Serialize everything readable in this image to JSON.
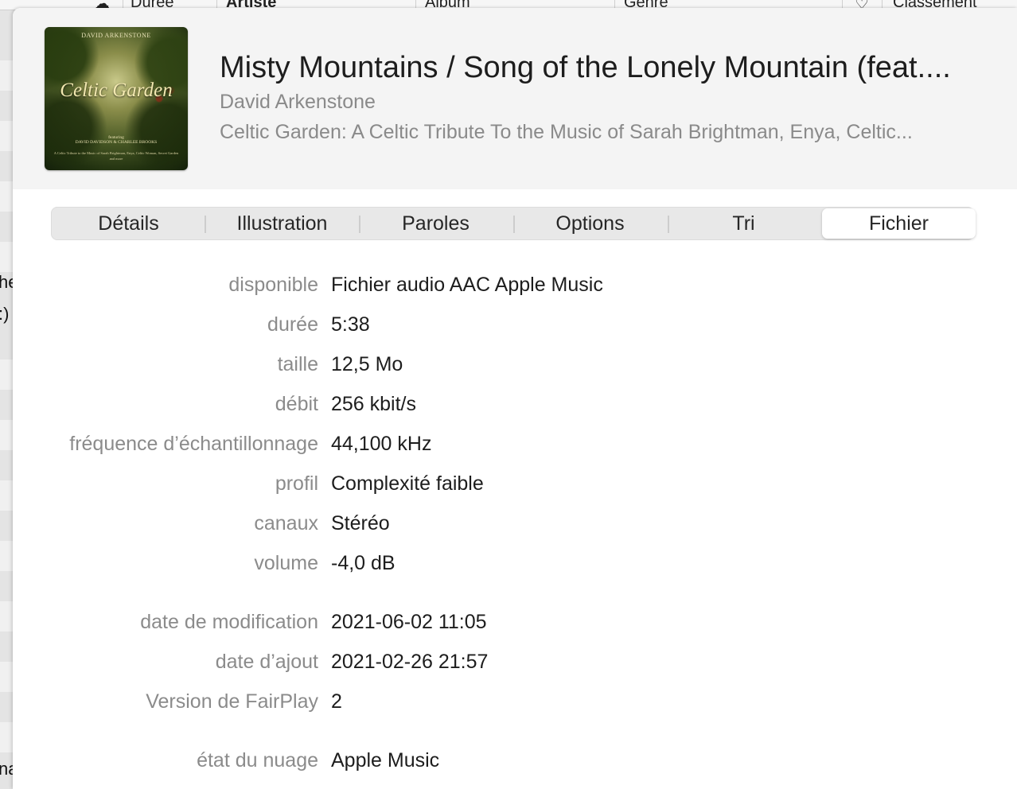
{
  "background": {
    "columns": [
      {
        "label": "Durée"
      },
      {
        "label": "Artiste"
      },
      {
        "label": "Album"
      },
      {
        "label": "Genre"
      },
      {
        "label": "Classement"
      }
    ],
    "left_fragments": [
      "he",
      ":)",
      "na"
    ]
  },
  "track": {
    "artwork": {
      "top_text": "DAVID ARKENSTONE",
      "title": "Celtic Garden",
      "featuring_label": "featuring",
      "credit": "DAVID DAVIDSON & CHARLEE BROOKS",
      "subtitle": "A Celtic Tribute to the Music of Sarah Brightman, Enya, Celtic Woman, Secret Garden and more"
    },
    "title": "Misty Mountains / Song of the Lonely Mountain (feat....",
    "artist": "David Arkenstone",
    "album": "Celtic Garden: A Celtic Tribute To the Music of Sarah Brightman, Enya, Celtic..."
  },
  "tabs": [
    {
      "label": "Détails",
      "selected": false
    },
    {
      "label": "Illustration",
      "selected": false
    },
    {
      "label": "Paroles",
      "selected": false
    },
    {
      "label": "Options",
      "selected": false
    },
    {
      "label": "Tri",
      "selected": false
    },
    {
      "label": "Fichier",
      "selected": true
    }
  ],
  "file_info": [
    {
      "label": "disponible",
      "value": "Fichier audio AAC Apple Music"
    },
    {
      "label": "durée",
      "value": "5:38"
    },
    {
      "label": "taille",
      "value": "12,5 Mo"
    },
    {
      "label": "débit",
      "value": "256 kbit/s"
    },
    {
      "label": "fréquence d’échantillonnage",
      "value": "44,100 kHz"
    },
    {
      "label": "profil",
      "value": "Complexité faible"
    },
    {
      "label": "canaux",
      "value": "Stéréo"
    },
    {
      "label": "volume",
      "value": "-4,0 dB"
    },
    {
      "label": "date de modification",
      "value": "2021-06-02 11:05"
    },
    {
      "label": "date d’ajout",
      "value": "2021-02-26 21:57"
    },
    {
      "label": "Version de FairPlay",
      "value": "2"
    },
    {
      "label": "état du nuage",
      "value": "Apple Music"
    }
  ],
  "colors": {
    "label_gray": "#8b8b8b",
    "value_dark": "#1d1d1d",
    "header_bg": "#f4f4f4"
  }
}
